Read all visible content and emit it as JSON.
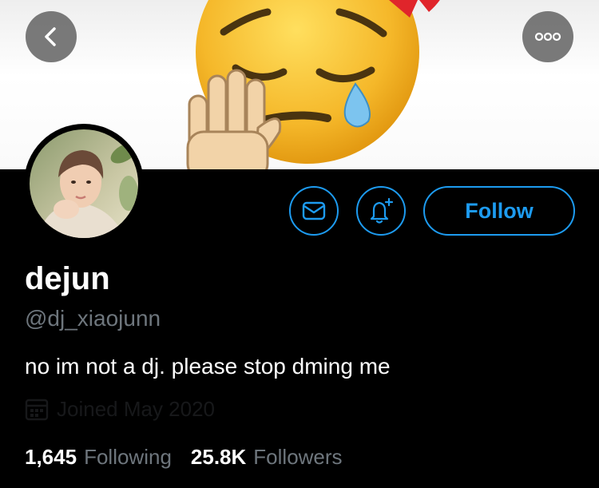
{
  "profile": {
    "display_name": "dejun",
    "handle": "@dj_xiaojunn",
    "bio": "no im not a dj. please stop dming me",
    "joined": "Joined May 2020"
  },
  "actions": {
    "follow_label": "Follow"
  },
  "stats": {
    "following_count": "1,645",
    "following_label": "Following",
    "followers_count": "25.8K",
    "followers_label": "Followers"
  },
  "icons": {
    "back": "back-arrow-icon",
    "more": "more-options-icon",
    "message": "envelope-icon",
    "notify": "bell-plus-icon",
    "calendar": "calendar-icon"
  },
  "colors": {
    "background": "#000000",
    "accent": "#1d9bf0",
    "secondary_text": "#6e767d",
    "primary_text": "#ffffff"
  }
}
